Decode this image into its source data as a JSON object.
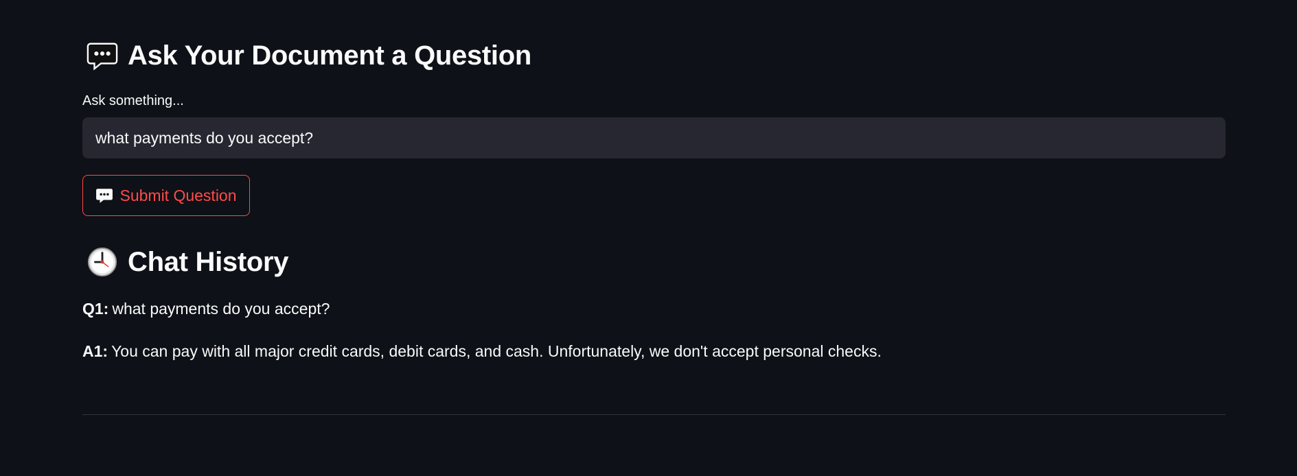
{
  "main": {
    "title": "Ask Your Document a Question",
    "title_icon": "speech-balloon-icon",
    "input": {
      "label": "Ask something...",
      "value": "what payments do you accept?"
    },
    "submit_button": {
      "label": "Submit Question",
      "icon": "speech-balloon-icon"
    },
    "history": {
      "title": "Chat History",
      "title_icon": "clock-icon",
      "entries": [
        {
          "q_label": "Q1:",
          "question": "what payments do you accept?",
          "a_label": "A1:",
          "answer": "You can pay with all major credit cards, debit cards, and cash. Unfortunately, we don't accept personal checks."
        }
      ]
    }
  },
  "colors": {
    "background": "#0e1117",
    "input_background": "#262730",
    "accent": "#ff4b4b",
    "text": "#fafafa",
    "divider": "#31333f"
  }
}
